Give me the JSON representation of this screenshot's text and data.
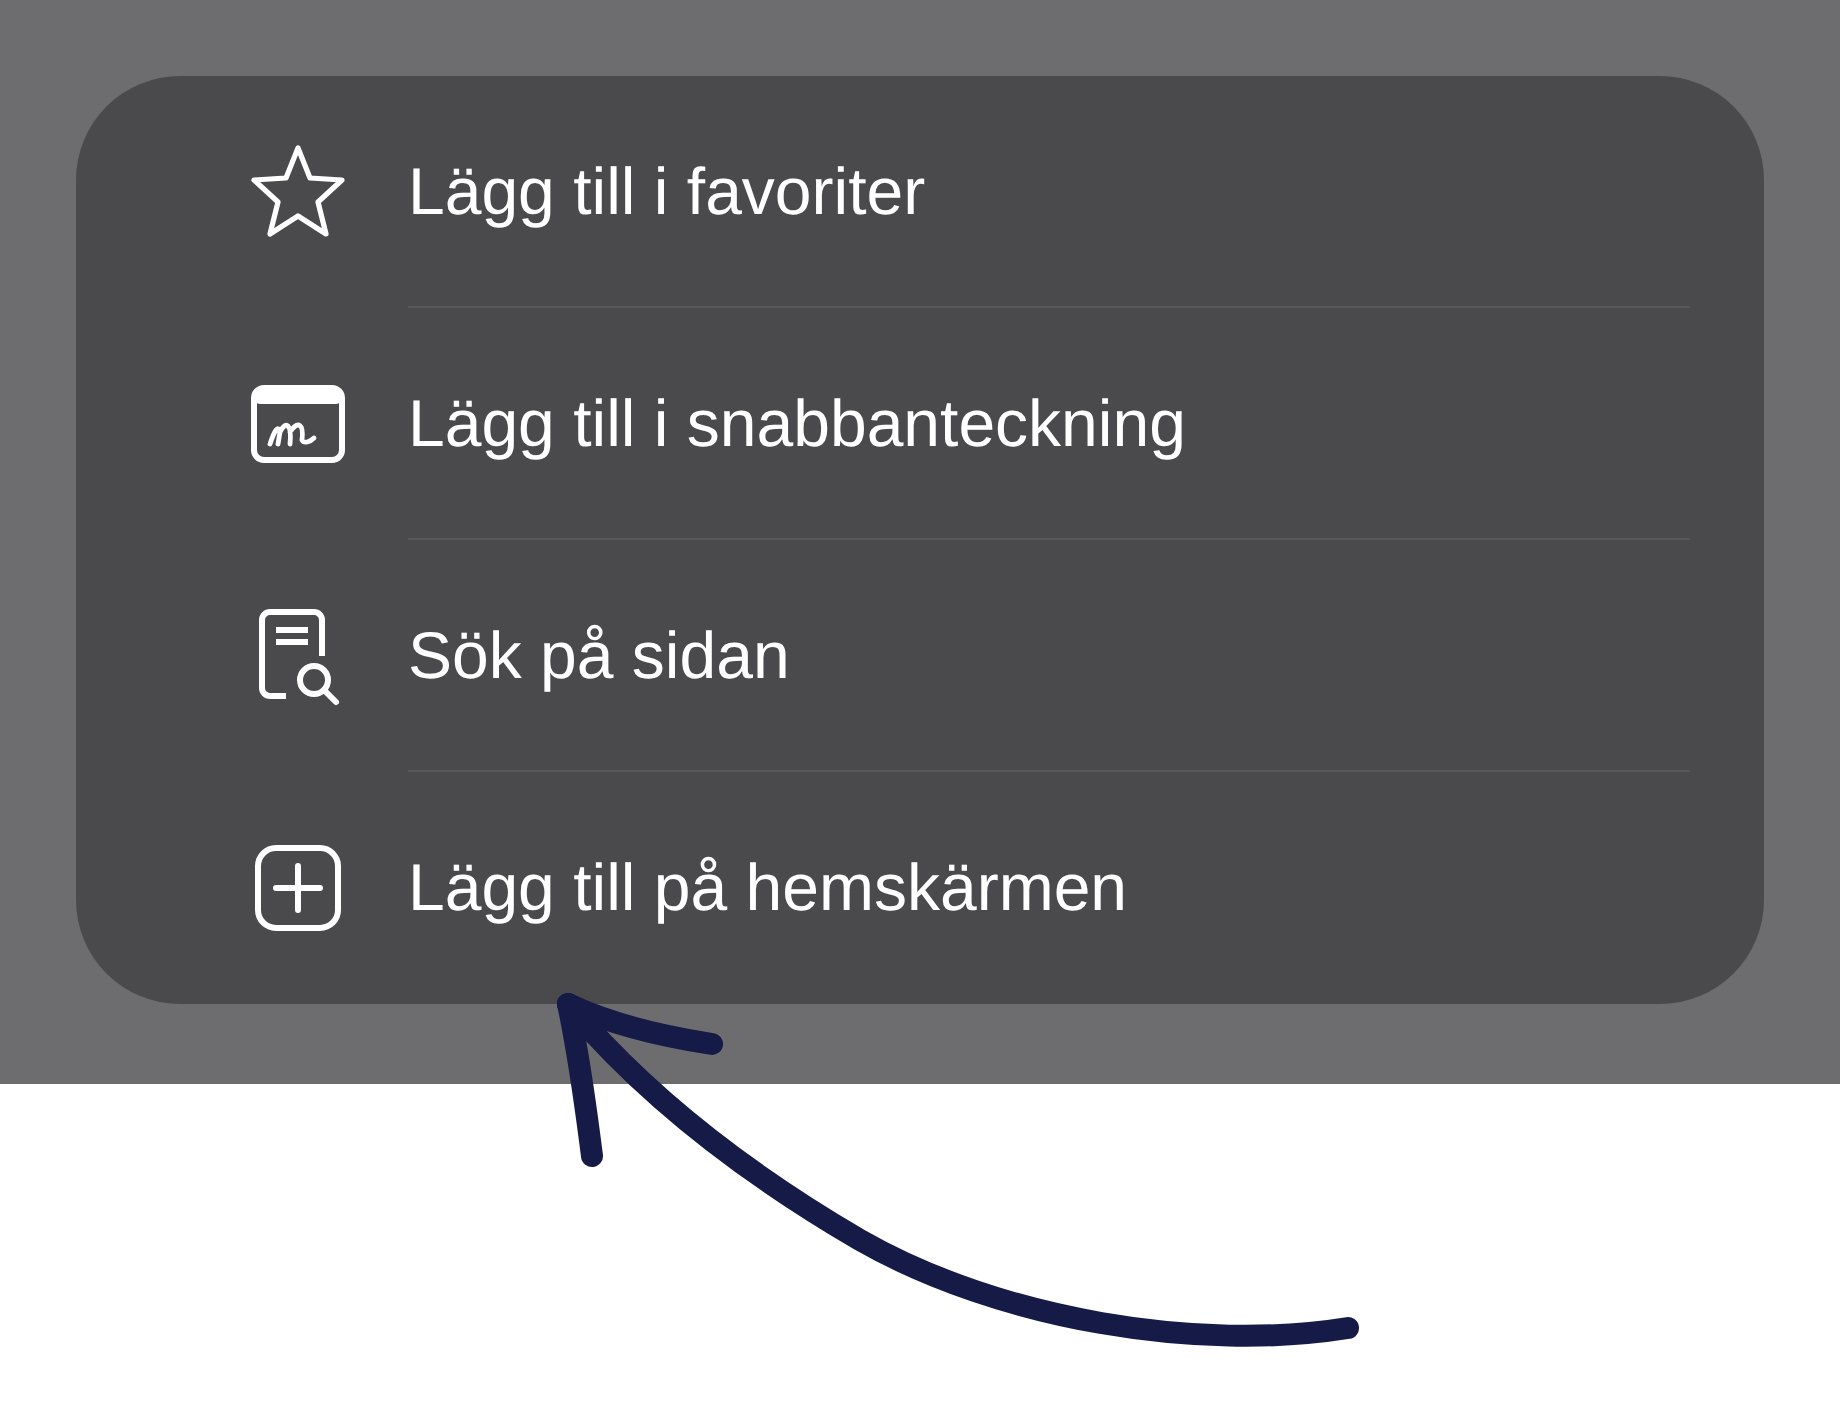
{
  "menu": {
    "items": [
      {
        "label": "Lägg till i favoriter"
      },
      {
        "label": "Lägg till i snabbanteckning"
      },
      {
        "label": "Sök på sidan"
      },
      {
        "label": "Lägg till på hemskärmen"
      }
    ]
  }
}
